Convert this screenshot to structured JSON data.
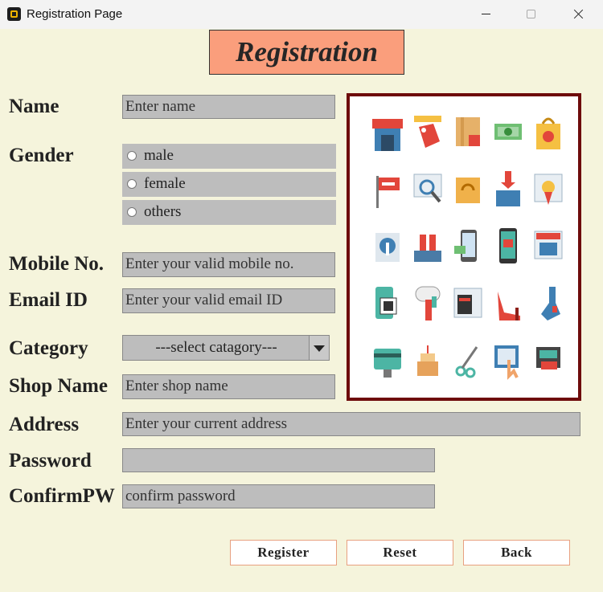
{
  "window": {
    "title": "Registration Page"
  },
  "heading": "Registration",
  "form": {
    "name": {
      "label": "Name",
      "placeholder": "Enter name"
    },
    "gender": {
      "label": "Gender",
      "options": [
        "male",
        "female",
        "others"
      ]
    },
    "mobile": {
      "label": "Mobile No.",
      "placeholder": "Enter your valid mobile no."
    },
    "email": {
      "label": "Email ID",
      "placeholder": "Enter your valid email ID"
    },
    "category": {
      "label": "Category",
      "selected": "---select catagory---"
    },
    "shop": {
      "label": "Shop Name",
      "placeholder": "Enter shop name"
    },
    "address": {
      "label": "Address",
      "placeholder": "Enter your current address"
    },
    "password": {
      "label": "Password",
      "value": ""
    },
    "confirm": {
      "label": "ConfirmPW",
      "placeholder": "confirm password"
    }
  },
  "buttons": {
    "register": "Register",
    "reset": "Reset",
    "back": "Back"
  },
  "image": {
    "icons": [
      "storefront-icon",
      "price-tag-icon",
      "package-lock-icon",
      "cash-icon",
      "shopping-bag-icon",
      "sale-flag-icon",
      "search-browser-icon",
      "refresh-box-icon",
      "basket-download-icon",
      "certificate-icon",
      "settings-tools-icon",
      "gift-laptop-icon",
      "mobile-payment-icon",
      "mobile-shop-icon",
      "online-store-icon",
      "qr-code-icon",
      "mailbox-icon",
      "web-shop-icon",
      "high-heel-icon",
      "sock-tag-icon",
      "credit-card-icon",
      "birthday-cake-icon",
      "scissors-coupon-icon",
      "click-shop-icon",
      "pos-terminal-icon"
    ],
    "colors": {
      "border": "#6e0b0b",
      "blue": "#3f7fb3",
      "red": "#e2463b",
      "yellow": "#f5c042",
      "teal": "#4cb5a4"
    }
  }
}
